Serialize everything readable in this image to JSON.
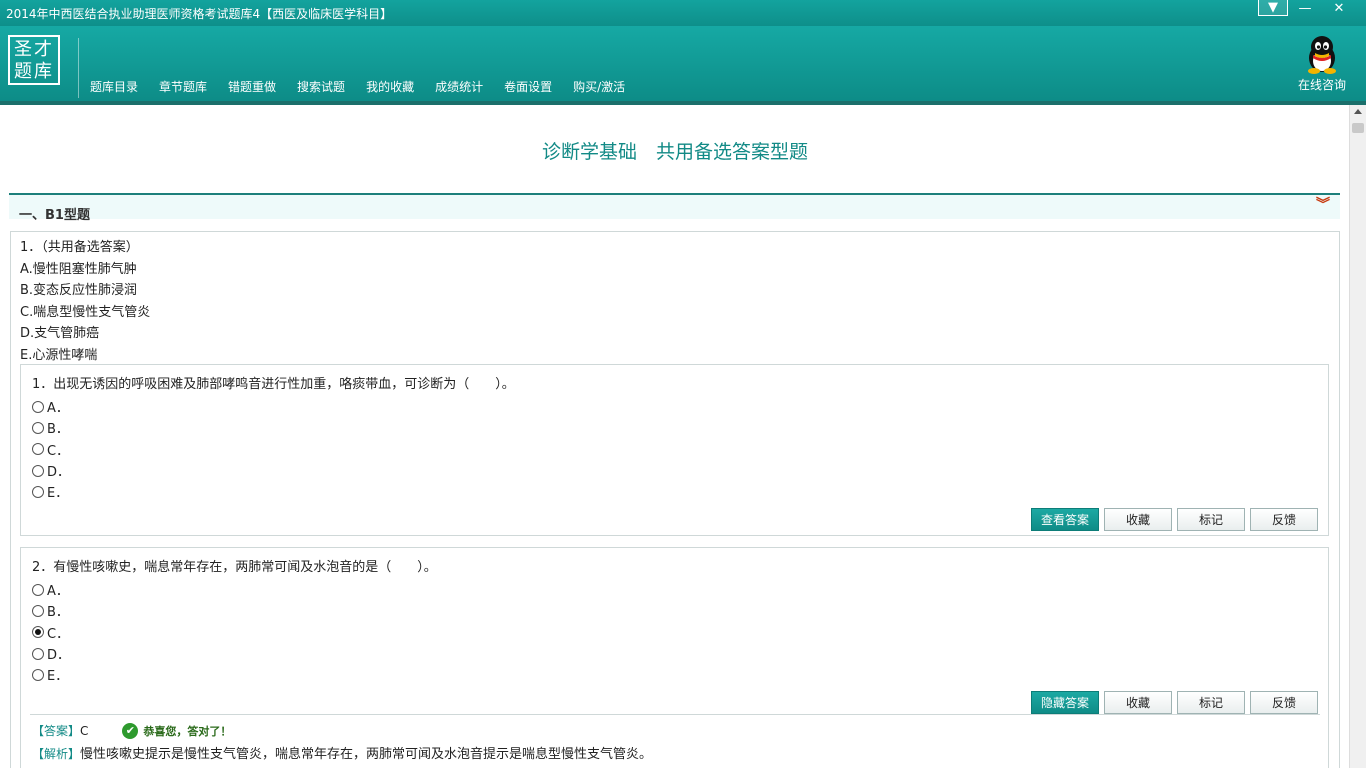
{
  "window": {
    "title": "2014年中西医结合执业助理医师资格考试题库4【西医及临床医学科目】",
    "controls": {
      "menu": "▼",
      "minimize": "—",
      "close": "✕"
    }
  },
  "header": {
    "logo_line1": "圣才",
    "logo_line2": "题库",
    "nav": [
      "题库目录",
      "章节题库",
      "错题重做",
      "搜索试题",
      "我的收藏",
      "成绩统计",
      "卷面设置",
      "购买/激活"
    ],
    "consult_label": "在线咨询"
  },
  "main": {
    "page_title": "诊断学基础　共用备选答案型题",
    "section_label": "一、B1型题",
    "stem": {
      "heading": "1．（共用备选答案）",
      "options": [
        "A.慢性阻塞性肺气肿",
        "B.变态反应性肺浸润",
        "C.喘息型慢性支气管炎",
        "D.支气管肺癌",
        "E.心源性哮喘"
      ]
    },
    "questions": [
      {
        "text": "1．出现无诱因的呼吸困难及肺部哮鸣音进行性加重，咯痰带血，可诊断为（　　）。",
        "options": [
          "A．",
          "B．",
          "C．",
          "D．",
          "E．"
        ],
        "selected": null,
        "buttons": [
          "查看答案",
          "收藏",
          "标记",
          "反馈"
        ]
      },
      {
        "text": "2．有慢性咳嗽史，喘息常年存在，两肺常可闻及水泡音的是（　　）。",
        "options": [
          "A．",
          "B．",
          "C．",
          "D．",
          "E．"
        ],
        "selected": "C",
        "buttons": [
          "隐藏答案",
          "收藏",
          "标记",
          "反馈"
        ],
        "answer_tag": "【答案】",
        "answer_value": "C",
        "feedback": "恭喜您，答对了！",
        "analysis_tag": "【解析】",
        "analysis_text": "慢性咳嗽史提示是慢性支气管炎，喘息常年存在，两肺常可闻及水泡音提示是喘息型慢性支气管炎。"
      }
    ]
  },
  "colors": {
    "accent": "#128a86",
    "header": "#13a39e",
    "collapse": "#c83a10",
    "ok": "#2e9a2e"
  },
  "icons": [
    "qq-icon",
    "collapse-double-chevron-icon",
    "check-icon"
  ]
}
